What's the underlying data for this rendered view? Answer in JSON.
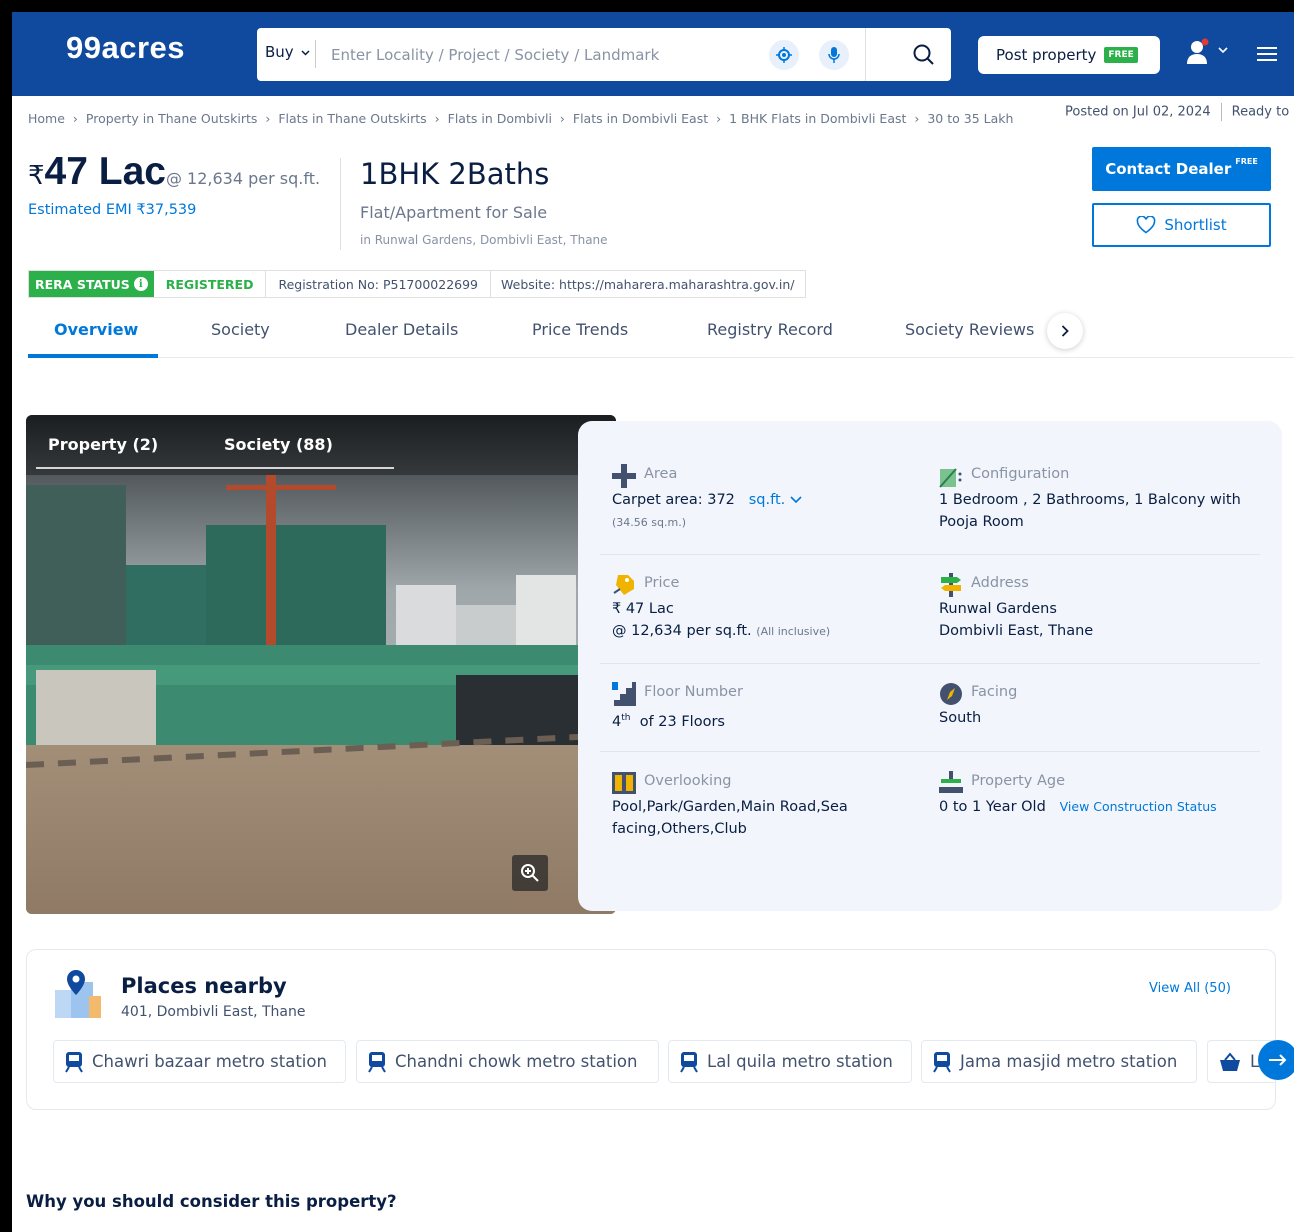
{
  "header": {
    "logo": "99acres",
    "buy_label": "Buy",
    "search_placeholder": "Enter Locality / Project / Society / Landmark",
    "post_property_label": "Post property",
    "post_property_badge": "FREE"
  },
  "breadcrumb": [
    "Home",
    "Property in Thane Outskirts",
    "Flats in Thane Outskirts",
    "Flats in Dombivli",
    "Flats in Dombivli East",
    "1 BHK Flats in Dombivli East",
    "30 to 35 Lakh"
  ],
  "posted": {
    "date": "Posted on Jul 02, 2024",
    "status": "Ready to m"
  },
  "listing": {
    "rupee": "₹",
    "price": "47 Lac",
    "per_sqft": "@ 12,634 per sq.ft.",
    "emi": "Estimated EMI ₹37,539",
    "title": "1BHK 2Baths",
    "subtitle": "Flat/Apartment for Sale",
    "location": "in Runwal Gardens, Dombivli East, Thane",
    "contact_label": "Contact Dealer",
    "contact_badge": "FREE",
    "shortlist_label": "Shortlist"
  },
  "rera": {
    "status_label": "RERA STATUS",
    "info_glyph": "i",
    "registered": "REGISTERED",
    "registration_no": "Registration No: P51700022699",
    "website": "Website: https://maharera.maharashtra.gov.in/"
  },
  "tabs": [
    "Overview",
    "Society",
    "Dealer Details",
    "Price Trends",
    "Registry Record",
    "Society Reviews"
  ],
  "photo_tabs": [
    "Property (2)",
    "Society (88)"
  ],
  "details": {
    "area": {
      "label": "Area",
      "prefix": "Carpet area: 372",
      "unit": "sq.ft.",
      "sub": "(34.56 sq.m.)"
    },
    "configuration": {
      "label": "Configuration",
      "line1": "1 Bedroom , 2 Bathrooms, 1 Balcony with",
      "line2": "Pooja Room"
    },
    "price": {
      "label": "Price",
      "line1": "₹ 47 Lac",
      "line2": "@ 12,634 per sq.ft.",
      "note": "(All inclusive)"
    },
    "address": {
      "label": "Address",
      "line1": "Runwal Gardens",
      "line2": "Dombivli East, Thane"
    },
    "floor": {
      "label": "Floor Number",
      "num": "4",
      "sup": "th",
      "rest": "of 23 Floors"
    },
    "facing": {
      "label": "Facing",
      "value": "South"
    },
    "overlooking": {
      "label": "Overlooking",
      "line1": "Pool,Park/Garden,Main Road,Sea",
      "line2": "facing,Others,Club"
    },
    "age": {
      "label": "Property Age",
      "value": "0 to 1 Year Old",
      "link": "View Construction Status"
    }
  },
  "places": {
    "title": "Places nearby",
    "subtitle": "401, Dombivli East, Thane",
    "view_all": "View All (50)",
    "chips": [
      "Chawri bazaar metro station",
      "Chandni chowk metro station",
      "Lal quila metro station",
      "Jama masjid metro station",
      "L"
    ]
  },
  "why_title": "Why you should consider this property?",
  "colors": {
    "brand": "#0f4a9e",
    "accent": "#0078db",
    "rera_green": "#2bb04a"
  }
}
